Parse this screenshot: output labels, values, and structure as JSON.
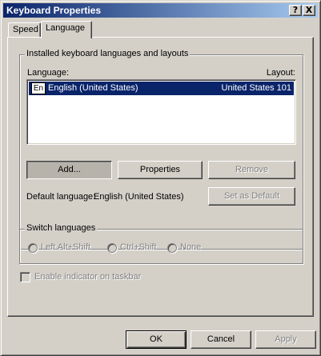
{
  "window": {
    "title": "Keyboard Properties"
  },
  "titlebar_buttons": {
    "help": "?",
    "close": "X"
  },
  "tabs": [
    {
      "label": "Speed",
      "active": false
    },
    {
      "label": "Language",
      "active": true
    }
  ],
  "installed_group": {
    "title": "Installed keyboard languages and layouts",
    "col_language": "Language:",
    "col_layout": "Layout:",
    "rows": [
      {
        "badge": "En",
        "language": "English (United States)",
        "layout": "United States 101",
        "selected": true
      }
    ]
  },
  "buttons": {
    "add": "Add...",
    "properties": "Properties",
    "remove": "Remove",
    "set_default": "Set as Default",
    "ok": "OK",
    "cancel": "Cancel",
    "apply": "Apply"
  },
  "default_language": {
    "label": "Default language:",
    "value": "English (United States)"
  },
  "switch_group": {
    "title": "Switch languages",
    "options": [
      "Left Alt+Shift",
      "Ctrl+Shift",
      "None"
    ]
  },
  "indicator": {
    "label": "Enable indicator on taskbar",
    "checked": false
  },
  "colors": {
    "title_start": "#0a246a",
    "title_end": "#a6caf0",
    "face": "#d4d0c8",
    "selection": "#0a246a"
  }
}
